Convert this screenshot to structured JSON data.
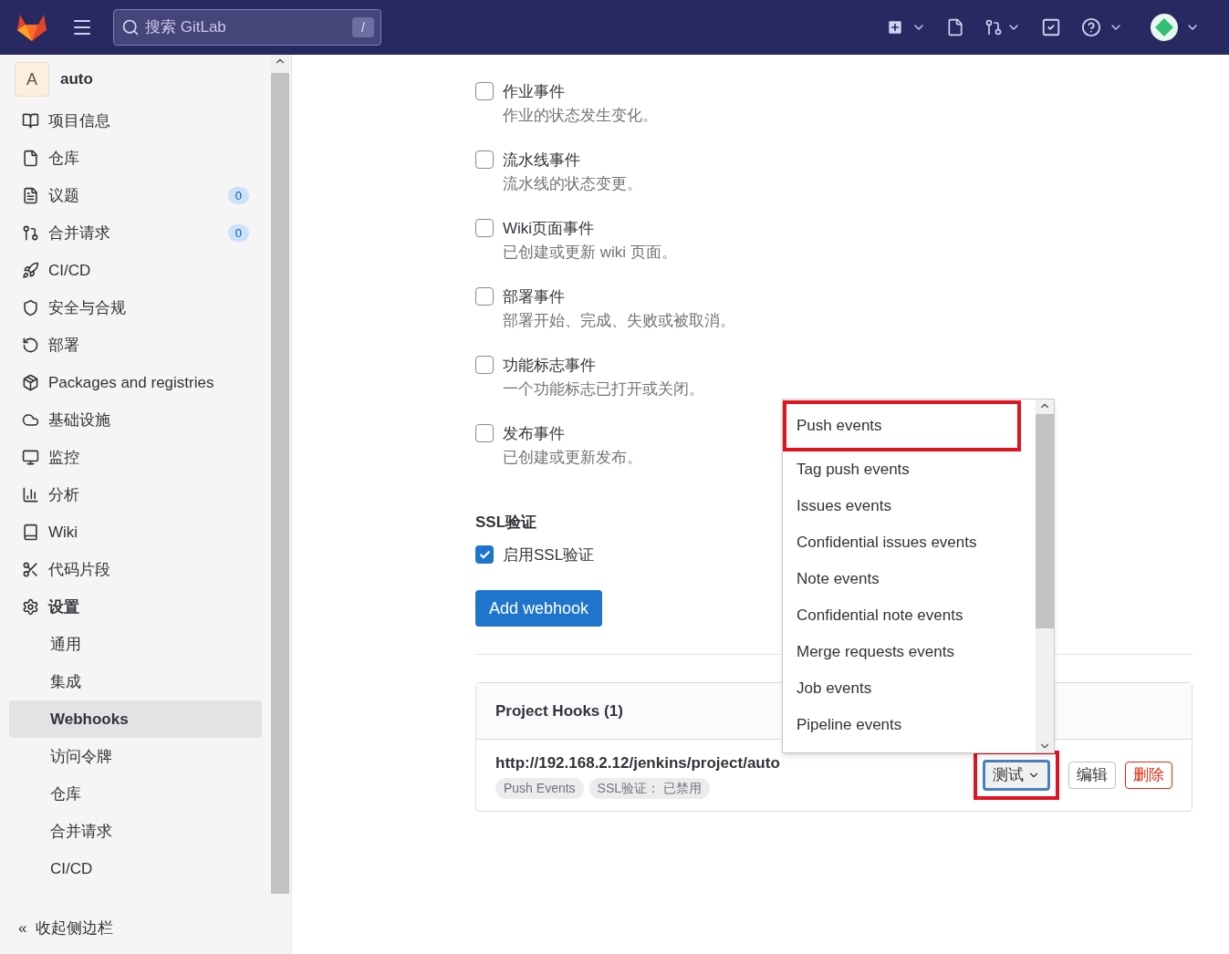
{
  "header": {
    "search": {
      "placeholder": "搜索 GitLab",
      "shortcut": "/"
    }
  },
  "sidebar": {
    "project": {
      "avatar": "A",
      "name": "auto"
    },
    "items": [
      {
        "label": "项目信息",
        "selected": false
      },
      {
        "label": "仓库",
        "selected": false
      },
      {
        "label": "议题",
        "selected": false,
        "badge": "0"
      },
      {
        "label": "合并请求",
        "selected": false,
        "badge": "0"
      },
      {
        "label": "CI/CD",
        "selected": false
      },
      {
        "label": "安全与合规",
        "selected": false
      },
      {
        "label": "部署",
        "selected": false
      },
      {
        "label": "Packages and registries",
        "selected": false
      },
      {
        "label": "基础设施",
        "selected": false
      },
      {
        "label": "监控",
        "selected": false
      },
      {
        "label": "分析",
        "selected": false
      },
      {
        "label": "Wiki",
        "selected": false
      },
      {
        "label": "代码片段",
        "selected": false
      },
      {
        "label": "设置",
        "selected": true,
        "children": [
          {
            "label": "通用",
            "selected": false
          },
          {
            "label": "集成",
            "selected": false
          },
          {
            "label": "Webhooks",
            "selected": true
          },
          {
            "label": "访问令牌",
            "selected": false
          },
          {
            "label": "仓库",
            "selected": false
          },
          {
            "label": "合并请求",
            "selected": false
          },
          {
            "label": "CI/CD",
            "selected": false
          }
        ]
      }
    ],
    "collapse": {
      "icon": "«",
      "label": "收起侧边栏"
    }
  },
  "events": [
    {
      "label": "作业事件",
      "description": "作业的状态发生变化。",
      "checked": false
    },
    {
      "label": "流水线事件",
      "description": "流水线的状态变更。",
      "checked": false
    },
    {
      "label": "Wiki页面事件",
      "description": "已创建或更新 wiki 页面。",
      "checked": false
    },
    {
      "label": "部署事件",
      "description": "部署开始、完成、失败或被取消。",
      "checked": false
    },
    {
      "label": "功能标志事件",
      "description": "一个功能标志已打开或关闭。",
      "checked": false
    },
    {
      "label": "发布事件",
      "description": "已创建或更新发布。",
      "checked": false
    }
  ],
  "ssl": {
    "title": "SSL验证",
    "label": "启用SSL验证",
    "checked": true
  },
  "add_button": "Add webhook",
  "hooks": {
    "title": "Project Hooks (1)",
    "items": [
      {
        "url": "http://192.168.2.12/jenkins/project/auto",
        "tags": [
          "Push Events",
          "SSL验证： 已禁用"
        ],
        "test": {
          "label": "测试",
          "annotated": true
        },
        "edit": "编辑",
        "delete": "删除"
      }
    ]
  },
  "dropdown": {
    "items": [
      {
        "label": "Push events",
        "annotated": true
      },
      {
        "label": "Tag push events",
        "annotated": false
      },
      {
        "label": "Issues events",
        "annotated": false
      },
      {
        "label": "Confidential issues events",
        "annotated": false
      },
      {
        "label": "Note events",
        "annotated": false
      },
      {
        "label": "Confidential note events",
        "annotated": false
      },
      {
        "label": "Merge requests events",
        "annotated": false
      },
      {
        "label": "Job events",
        "annotated": false
      },
      {
        "label": "Pipeline events",
        "annotated": false
      }
    ]
  }
}
